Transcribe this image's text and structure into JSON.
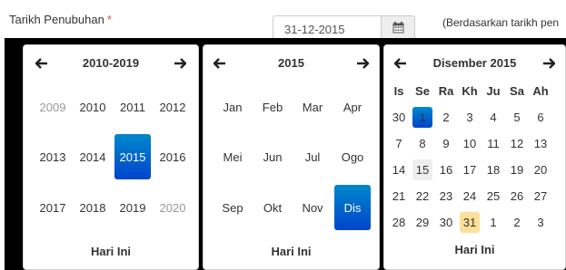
{
  "form": {
    "label": "Tarikh Penubuhan",
    "required_mark": "*",
    "date_value": "31-12-2015",
    "hint": "(Berdasarkan tarikh pen"
  },
  "decade_view": {
    "title": "2010-2019",
    "years": [
      "2009",
      "2010",
      "2011",
      "2012",
      "2013",
      "2014",
      "2015",
      "2016",
      "2017",
      "2018",
      "2019",
      "2020"
    ],
    "today_label": "Hari Ini"
  },
  "month_view": {
    "title": "2015",
    "months": [
      "Jan",
      "Feb",
      "Mar",
      "Apr",
      "Mei",
      "Jun",
      "Jul",
      "Ogo",
      "Sep",
      "Okt",
      "Nov",
      "Dis"
    ],
    "today_label": "Hari Ini"
  },
  "day_view": {
    "title": "Disember 2015",
    "weekdays": [
      "Is",
      "Se",
      "Ra",
      "Kh",
      "Ju",
      "Sa",
      "Ah"
    ],
    "weeks": [
      [
        "30",
        "1",
        "2",
        "3",
        "4",
        "5",
        "6"
      ],
      [
        "7",
        "8",
        "9",
        "10",
        "11",
        "12",
        "13"
      ],
      [
        "14",
        "15",
        "16",
        "17",
        "18",
        "19",
        "20"
      ],
      [
        "21",
        "22",
        "23",
        "24",
        "25",
        "26",
        "27"
      ],
      [
        "28",
        "29",
        "30",
        "31",
        "1",
        "2",
        "3"
      ]
    ],
    "today_label": "Hari Ini"
  },
  "colors": {
    "active_start": "#0088cc",
    "active_end": "#0044cc",
    "today_highlight": "#fde19a",
    "required": "#d9534f"
  },
  "icons": {
    "calendar": "calendar-icon",
    "prev": "arrow-left-icon",
    "next": "arrow-right-icon"
  }
}
